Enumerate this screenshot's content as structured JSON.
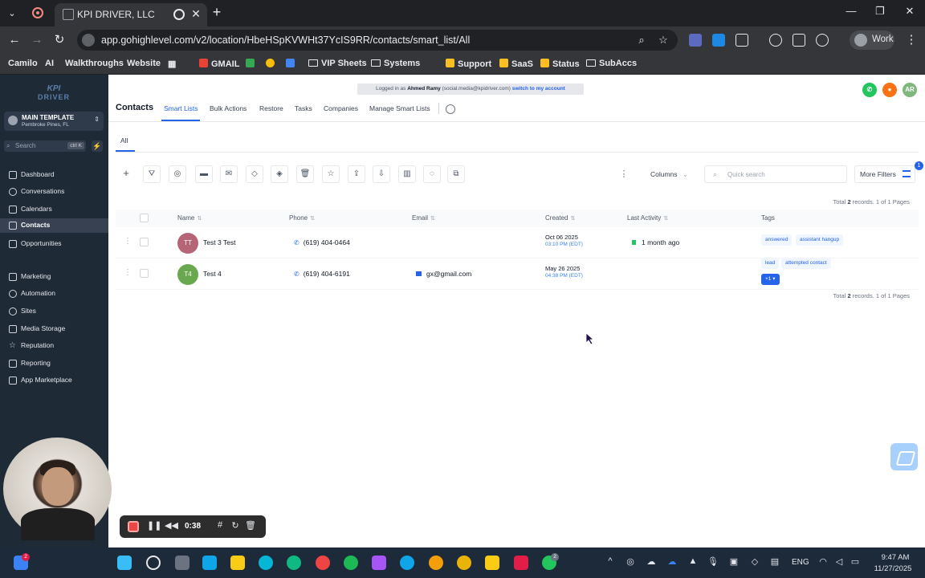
{
  "browser": {
    "tab_title": "KPI DRIVER, LLC",
    "url": "app.gohighlevel.com/v2/location/HbeHSpKVWHt37YcIS9RR/contacts/smart_list/All",
    "profile_label": "Work",
    "bookmarks": [
      "Camilo",
      "AI",
      "Walkthroughs",
      "Website",
      "GMAIL",
      "VIP Sheets",
      "Systems",
      "Support",
      "SaaS",
      "Status",
      "SubAccs"
    ]
  },
  "sidebar": {
    "logo_top": "KPI",
    "logo_bottom": "DRIVER",
    "account_name": "MAIN TEMPLATE",
    "account_location": "Pembroke Pines, FL",
    "search_placeholder": "Search",
    "search_shortcut": "ctrl K",
    "items": [
      {
        "label": "Dashboard",
        "icon": "dashboard-icon"
      },
      {
        "label": "Conversations",
        "icon": "chat-icon"
      },
      {
        "label": "Calendars",
        "icon": "calendar-icon"
      },
      {
        "label": "Contacts",
        "icon": "contacts-icon"
      },
      {
        "label": "Opportunities",
        "icon": "funnel-icon"
      },
      {
        "label": "Marketing",
        "icon": "megaphone-icon"
      },
      {
        "label": "Automation",
        "icon": "automation-icon"
      },
      {
        "label": "Sites",
        "icon": "globe-icon"
      },
      {
        "label": "Media Storage",
        "icon": "image-icon"
      },
      {
        "label": "Reputation",
        "icon": "star-icon"
      },
      {
        "label": "Reporting",
        "icon": "chart-icon"
      },
      {
        "label": "App Marketplace",
        "icon": "grid-icon"
      }
    ],
    "active_item": "Contacts"
  },
  "header": {
    "logged_in_prefix": "Logged in as",
    "logged_in_user": "Ahmed Ramy",
    "logged_in_email": "(social.media@kpidriver.com)",
    "switch_link": "switch to my account",
    "avatar_initials": "AR",
    "page_title": "Contacts",
    "tabs": [
      "Smart Lists",
      "Bulk Actions",
      "Restore",
      "Tasks",
      "Companies",
      "Manage Smart Lists"
    ],
    "active_tab": "Smart Lists"
  },
  "list": {
    "smart_list_tab": "All",
    "columns_button": "Columns",
    "quick_search_placeholder": "Quick search",
    "more_filters_label": "More Filters",
    "filter_count": "1",
    "total_text_prefix": "Total",
    "total_count": "2",
    "total_text_suffix": "records. 1 of 1 Pages",
    "headers": [
      "Name",
      "Phone",
      "Email",
      "Created",
      "Last Activity",
      "Tags"
    ],
    "rows": [
      {
        "initials": "TT",
        "avatar_color": "#b56576",
        "name": "Test 3 Test",
        "phone": "(619) 404-0464",
        "email": "",
        "created_date": "Oct 06 2025",
        "created_time": "03:10 PM (EDT)",
        "last_activity": "1 month ago",
        "tags": [
          "answered",
          "assistant hangup"
        ],
        "more_tags": ""
      },
      {
        "initials": "T4",
        "avatar_color": "#6aa84f",
        "name": "Test 4",
        "phone": "(619) 404-6191",
        "email": "gx@gmail.com",
        "created_date": "May 26 2025",
        "created_time": "04:38 PM (EDT)",
        "last_activity": "",
        "tags": [
          "lead",
          "attempted contact"
        ],
        "more_tags": "+1"
      }
    ]
  },
  "recorder": {
    "elapsed": "0:38"
  },
  "taskbar": {
    "language": "ENG",
    "time": "9:47 AM",
    "date": "11/27/2025",
    "badge_left": "2",
    "badge_whatsapp": "2"
  },
  "colors": {
    "accent": "#2563eb",
    "sidebar_bg": "#1f2a37",
    "phone_green": "#22c55e",
    "bell_orange": "#f97316",
    "avatar_green": "#7fb77e"
  }
}
